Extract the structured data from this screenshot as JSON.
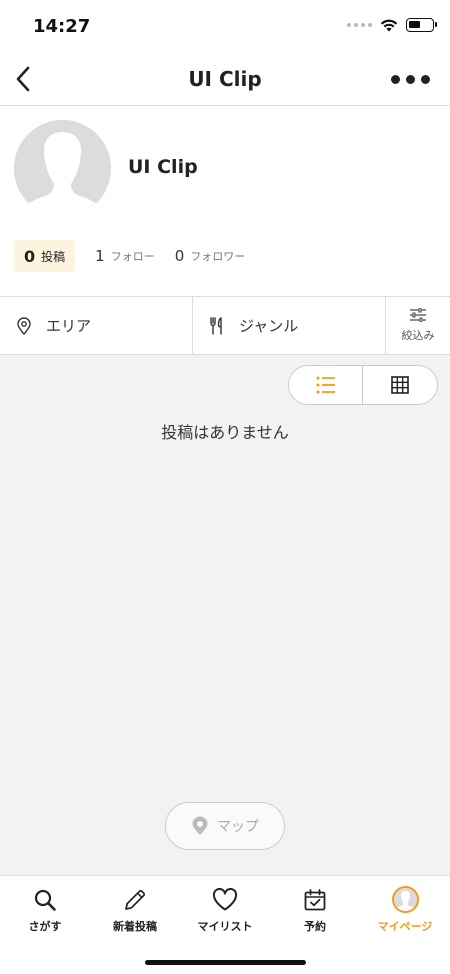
{
  "status_bar": {
    "time": "14:27"
  },
  "header": {
    "title": "UI Clip"
  },
  "profile": {
    "name": "UI Clip",
    "stats": {
      "posts_count": "0",
      "posts_label": "投稿",
      "following_count": "1",
      "following_label": "フォロー",
      "followers_count": "0",
      "followers_label": "フォロワー"
    }
  },
  "filters": {
    "area_label": "エリア",
    "genre_label": "ジャンル",
    "narrow_label": "絞込み"
  },
  "content": {
    "view_mode": "list",
    "empty_message": "投稿はありません",
    "map_button_label": "マップ"
  },
  "tabs": [
    {
      "label": "さがす",
      "icon": "search-icon"
    },
    {
      "label": "新着投稿",
      "icon": "pencil-icon"
    },
    {
      "label": "マイリスト",
      "icon": "heart-icon"
    },
    {
      "label": "予約",
      "icon": "calendar-check-icon"
    },
    {
      "label": "マイページ",
      "icon": "avatar-icon",
      "active": true
    }
  ],
  "colors": {
    "accent": "#f29b18",
    "posts_highlight": "#fdf4de",
    "content_bg": "#f2f2f2",
    "avatar_placeholder": "#dcdcdc"
  }
}
